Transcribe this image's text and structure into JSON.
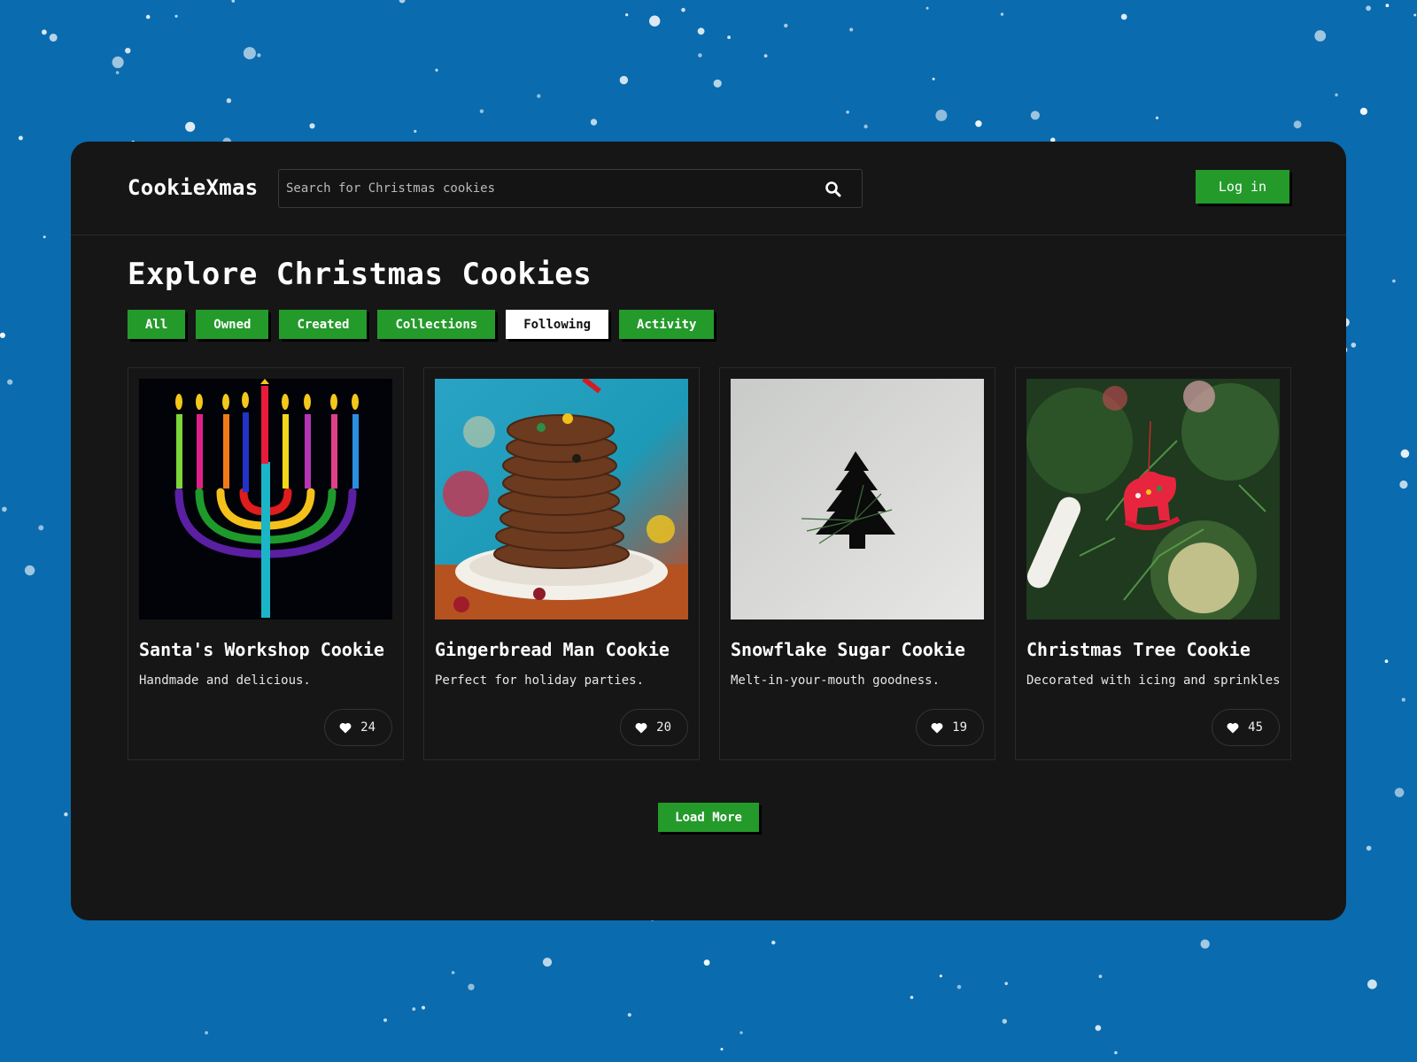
{
  "app": {
    "brand": "CookieXmas",
    "search": {
      "placeholder": "Search for Christmas cookies",
      "value": "",
      "icon": "search-icon"
    },
    "login_label": "Log in"
  },
  "page": {
    "title": "Explore Christmas Cookies",
    "tabs": [
      {
        "label": "All",
        "active": false
      },
      {
        "label": "Owned",
        "active": false
      },
      {
        "label": "Created",
        "active": false
      },
      {
        "label": "Collections",
        "active": false
      },
      {
        "label": "Following",
        "active": true
      },
      {
        "label": "Activity",
        "active": false
      }
    ],
    "cards": [
      {
        "title": "Santa's Workshop Cookie",
        "description": "Handmade and delicious.",
        "likes": "24",
        "image": "menorah-image"
      },
      {
        "title": "Gingerbread Man Cookie",
        "description": "Perfect for holiday parties.",
        "likes": "20",
        "image": "cookie-stack-image"
      },
      {
        "title": "Snowflake Sugar Cookie",
        "description": "Melt-in-your-mouth goodness.",
        "likes": "19",
        "image": "tree-cutout-image"
      },
      {
        "title": "Christmas Tree Cookie",
        "description": "Decorated with icing and sprinkles",
        "likes": "45",
        "image": "ornament-image"
      }
    ],
    "load_more_label": "Load More"
  },
  "colors": {
    "background": "#0a6bae",
    "panel": "#161616",
    "accent": "#249a2b"
  }
}
